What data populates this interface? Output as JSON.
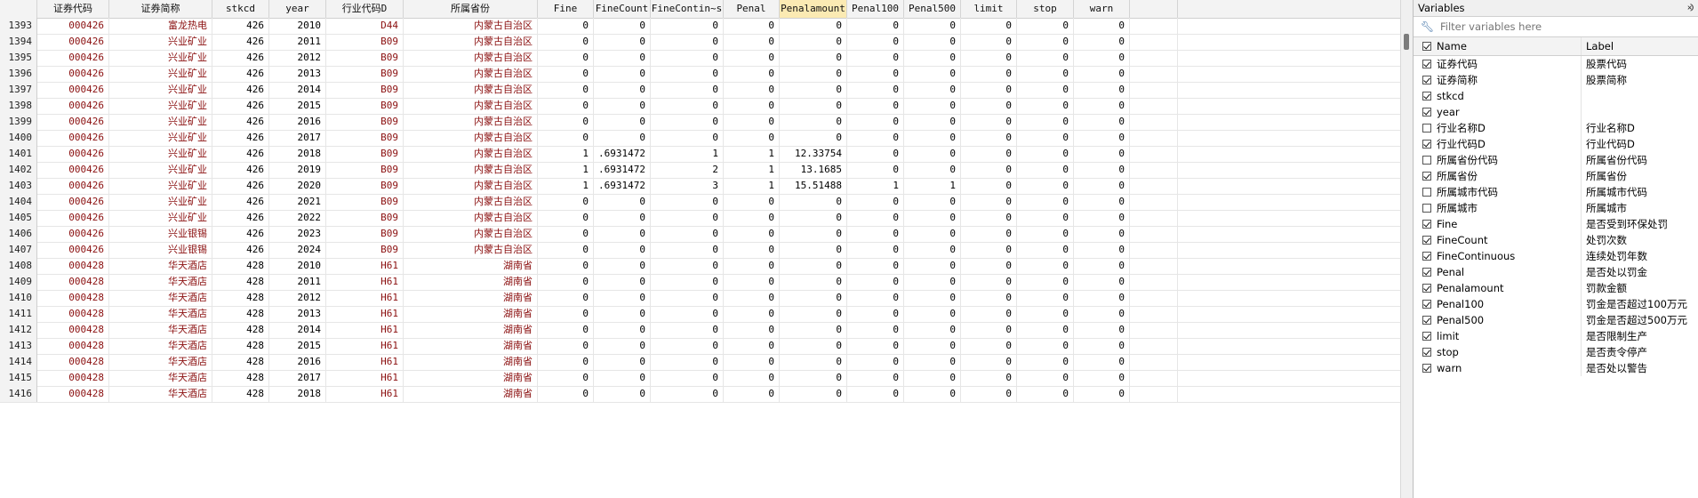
{
  "grid": {
    "columns": [
      {
        "key": "rownum",
        "label": "",
        "width": 42,
        "cls": "rn"
      },
      {
        "key": "c0",
        "label": "证券代码",
        "width": 81,
        "cls": "str"
      },
      {
        "key": "c1",
        "label": "证券简称",
        "width": 116,
        "cls": "str"
      },
      {
        "key": "c2",
        "label": "stkcd",
        "width": 64,
        "cls": "num"
      },
      {
        "key": "c3",
        "label": "year",
        "width": 64,
        "cls": "num"
      },
      {
        "key": "c4",
        "label": "行业代码D",
        "width": 87,
        "cls": "str"
      },
      {
        "key": "c5",
        "label": "所属省份",
        "width": 151,
        "cls": "str"
      },
      {
        "key": "c6",
        "label": "Fine",
        "width": 63,
        "cls": "num"
      },
      {
        "key": "c7",
        "label": "FineCount",
        "width": 64,
        "cls": "num"
      },
      {
        "key": "c8",
        "label": "FineContin~s",
        "width": 82,
        "cls": "num"
      },
      {
        "key": "c9",
        "label": "Penal",
        "width": 63,
        "cls": "num"
      },
      {
        "key": "c10",
        "label": "Penalamount",
        "width": 76,
        "cls": "num",
        "highlight": true
      },
      {
        "key": "c11",
        "label": "Penal100",
        "width": 64,
        "cls": "num"
      },
      {
        "key": "c12",
        "label": "Penal500",
        "width": 64,
        "cls": "num"
      },
      {
        "key": "c13",
        "label": "limit",
        "width": 63,
        "cls": "num"
      },
      {
        "key": "c14",
        "label": "stop",
        "width": 64,
        "cls": "num"
      },
      {
        "key": "c15",
        "label": "warn",
        "width": 63,
        "cls": "num"
      },
      {
        "key": "c16",
        "label": "",
        "width": 54,
        "cls": "num"
      }
    ],
    "rows": [
      [
        "1393",
        "000426",
        "富龙热电",
        "426",
        "2010",
        "D44",
        "内蒙古自治区",
        "0",
        "0",
        "0",
        "0",
        "0",
        "0",
        "0",
        "0",
        "0",
        "0",
        ""
      ],
      [
        "1394",
        "000426",
        "兴业矿业",
        "426",
        "2011",
        "B09",
        "内蒙古自治区",
        "0",
        "0",
        "0",
        "0",
        "0",
        "0",
        "0",
        "0",
        "0",
        "0",
        ""
      ],
      [
        "1395",
        "000426",
        "兴业矿业",
        "426",
        "2012",
        "B09",
        "内蒙古自治区",
        "0",
        "0",
        "0",
        "0",
        "0",
        "0",
        "0",
        "0",
        "0",
        "0",
        ""
      ],
      [
        "1396",
        "000426",
        "兴业矿业",
        "426",
        "2013",
        "B09",
        "内蒙古自治区",
        "0",
        "0",
        "0",
        "0",
        "0",
        "0",
        "0",
        "0",
        "0",
        "0",
        ""
      ],
      [
        "1397",
        "000426",
        "兴业矿业",
        "426",
        "2014",
        "B09",
        "内蒙古自治区",
        "0",
        "0",
        "0",
        "0",
        "0",
        "0",
        "0",
        "0",
        "0",
        "0",
        ""
      ],
      [
        "1398",
        "000426",
        "兴业矿业",
        "426",
        "2015",
        "B09",
        "内蒙古自治区",
        "0",
        "0",
        "0",
        "0",
        "0",
        "0",
        "0",
        "0",
        "0",
        "0",
        ""
      ],
      [
        "1399",
        "000426",
        "兴业矿业",
        "426",
        "2016",
        "B09",
        "内蒙古自治区",
        "0",
        "0",
        "0",
        "0",
        "0",
        "0",
        "0",
        "0",
        "0",
        "0",
        ""
      ],
      [
        "1400",
        "000426",
        "兴业矿业",
        "426",
        "2017",
        "B09",
        "内蒙古自治区",
        "0",
        "0",
        "0",
        "0",
        "0",
        "0",
        "0",
        "0",
        "0",
        "0",
        ""
      ],
      [
        "1401",
        "000426",
        "兴业矿业",
        "426",
        "2018",
        "B09",
        "内蒙古自治区",
        "1",
        ".6931472",
        "1",
        "1",
        "12.33754",
        "0",
        "0",
        "0",
        "0",
        "0",
        ""
      ],
      [
        "1402",
        "000426",
        "兴业矿业",
        "426",
        "2019",
        "B09",
        "内蒙古自治区",
        "1",
        ".6931472",
        "2",
        "1",
        "13.1685",
        "0",
        "0",
        "0",
        "0",
        "0",
        ""
      ],
      [
        "1403",
        "000426",
        "兴业矿业",
        "426",
        "2020",
        "B09",
        "内蒙古自治区",
        "1",
        ".6931472",
        "3",
        "1",
        "15.51488",
        "1",
        "1",
        "0",
        "0",
        "0",
        ""
      ],
      [
        "1404",
        "000426",
        "兴业矿业",
        "426",
        "2021",
        "B09",
        "内蒙古自治区",
        "0",
        "0",
        "0",
        "0",
        "0",
        "0",
        "0",
        "0",
        "0",
        "0",
        ""
      ],
      [
        "1405",
        "000426",
        "兴业矿业",
        "426",
        "2022",
        "B09",
        "内蒙古自治区",
        "0",
        "0",
        "0",
        "0",
        "0",
        "0",
        "0",
        "0",
        "0",
        "0",
        ""
      ],
      [
        "1406",
        "000426",
        "兴业银锡",
        "426",
        "2023",
        "B09",
        "内蒙古自治区",
        "0",
        "0",
        "0",
        "0",
        "0",
        "0",
        "0",
        "0",
        "0",
        "0",
        ""
      ],
      [
        "1407",
        "000426",
        "兴业银锡",
        "426",
        "2024",
        "B09",
        "内蒙古自治区",
        "0",
        "0",
        "0",
        "0",
        "0",
        "0",
        "0",
        "0",
        "0",
        "0",
        ""
      ],
      [
        "1408",
        "000428",
        "华天酒店",
        "428",
        "2010",
        "H61",
        "湖南省",
        "0",
        "0",
        "0",
        "0",
        "0",
        "0",
        "0",
        "0",
        "0",
        "0",
        ""
      ],
      [
        "1409",
        "000428",
        "华天酒店",
        "428",
        "2011",
        "H61",
        "湖南省",
        "0",
        "0",
        "0",
        "0",
        "0",
        "0",
        "0",
        "0",
        "0",
        "0",
        ""
      ],
      [
        "1410",
        "000428",
        "华天酒店",
        "428",
        "2012",
        "H61",
        "湖南省",
        "0",
        "0",
        "0",
        "0",
        "0",
        "0",
        "0",
        "0",
        "0",
        "0",
        ""
      ],
      [
        "1411",
        "000428",
        "华天酒店",
        "428",
        "2013",
        "H61",
        "湖南省",
        "0",
        "0",
        "0",
        "0",
        "0",
        "0",
        "0",
        "0",
        "0",
        "0",
        ""
      ],
      [
        "1412",
        "000428",
        "华天酒店",
        "428",
        "2014",
        "H61",
        "湖南省",
        "0",
        "0",
        "0",
        "0",
        "0",
        "0",
        "0",
        "0",
        "0",
        "0",
        ""
      ],
      [
        "1413",
        "000428",
        "华天酒店",
        "428",
        "2015",
        "H61",
        "湖南省",
        "0",
        "0",
        "0",
        "0",
        "0",
        "0",
        "0",
        "0",
        "0",
        "0",
        ""
      ],
      [
        "1414",
        "000428",
        "华天酒店",
        "428",
        "2016",
        "H61",
        "湖南省",
        "0",
        "0",
        "0",
        "0",
        "0",
        "0",
        "0",
        "0",
        "0",
        "0",
        ""
      ],
      [
        "1415",
        "000428",
        "华天酒店",
        "428",
        "2017",
        "H61",
        "湖南省",
        "0",
        "0",
        "0",
        "0",
        "0",
        "0",
        "0",
        "0",
        "0",
        "0",
        ""
      ],
      [
        "1416",
        "000428",
        "华天酒店",
        "428",
        "2018",
        "H61",
        "湖南省",
        "0",
        "0",
        "0",
        "0",
        "0",
        "0",
        "0",
        "0",
        "0",
        "0",
        ""
      ]
    ]
  },
  "variables": {
    "title": "Variables",
    "filter_placeholder": "Filter variables here",
    "col_name": "Name",
    "col_label": "Label",
    "items": [
      {
        "name": "证券代码",
        "label": "股票代码",
        "checked": true
      },
      {
        "name": "证券简称",
        "label": "股票简称",
        "checked": true
      },
      {
        "name": "stkcd",
        "label": "",
        "checked": true
      },
      {
        "name": "year",
        "label": "",
        "checked": true
      },
      {
        "name": "行业名称D",
        "label": "行业名称D",
        "checked": false
      },
      {
        "name": "行业代码D",
        "label": "行业代码D",
        "checked": true
      },
      {
        "name": "所属省份代码",
        "label": "所属省份代码",
        "checked": false
      },
      {
        "name": "所属省份",
        "label": "所属省份",
        "checked": true
      },
      {
        "name": "所属城市代码",
        "label": "所属城市代码",
        "checked": false
      },
      {
        "name": "所属城市",
        "label": "所属城市",
        "checked": false
      },
      {
        "name": "Fine",
        "label": "是否受到环保处罚",
        "checked": true
      },
      {
        "name": "FineCount",
        "label": "处罚次数",
        "checked": true
      },
      {
        "name": "FineContinuous",
        "label": "连续处罚年数",
        "checked": true
      },
      {
        "name": "Penal",
        "label": "是否处以罚金",
        "checked": true
      },
      {
        "name": "Penalamount",
        "label": "罚款金额",
        "checked": true
      },
      {
        "name": "Penal100",
        "label": "罚金是否超过100万元",
        "checked": true
      },
      {
        "name": "Penal500",
        "label": "罚金是否超过500万元",
        "checked": true
      },
      {
        "name": "limit",
        "label": "是否限制生产",
        "checked": true
      },
      {
        "name": "stop",
        "label": "是否责令停产",
        "checked": true
      },
      {
        "name": "warn",
        "label": "是否处以警告",
        "checked": true
      }
    ]
  }
}
